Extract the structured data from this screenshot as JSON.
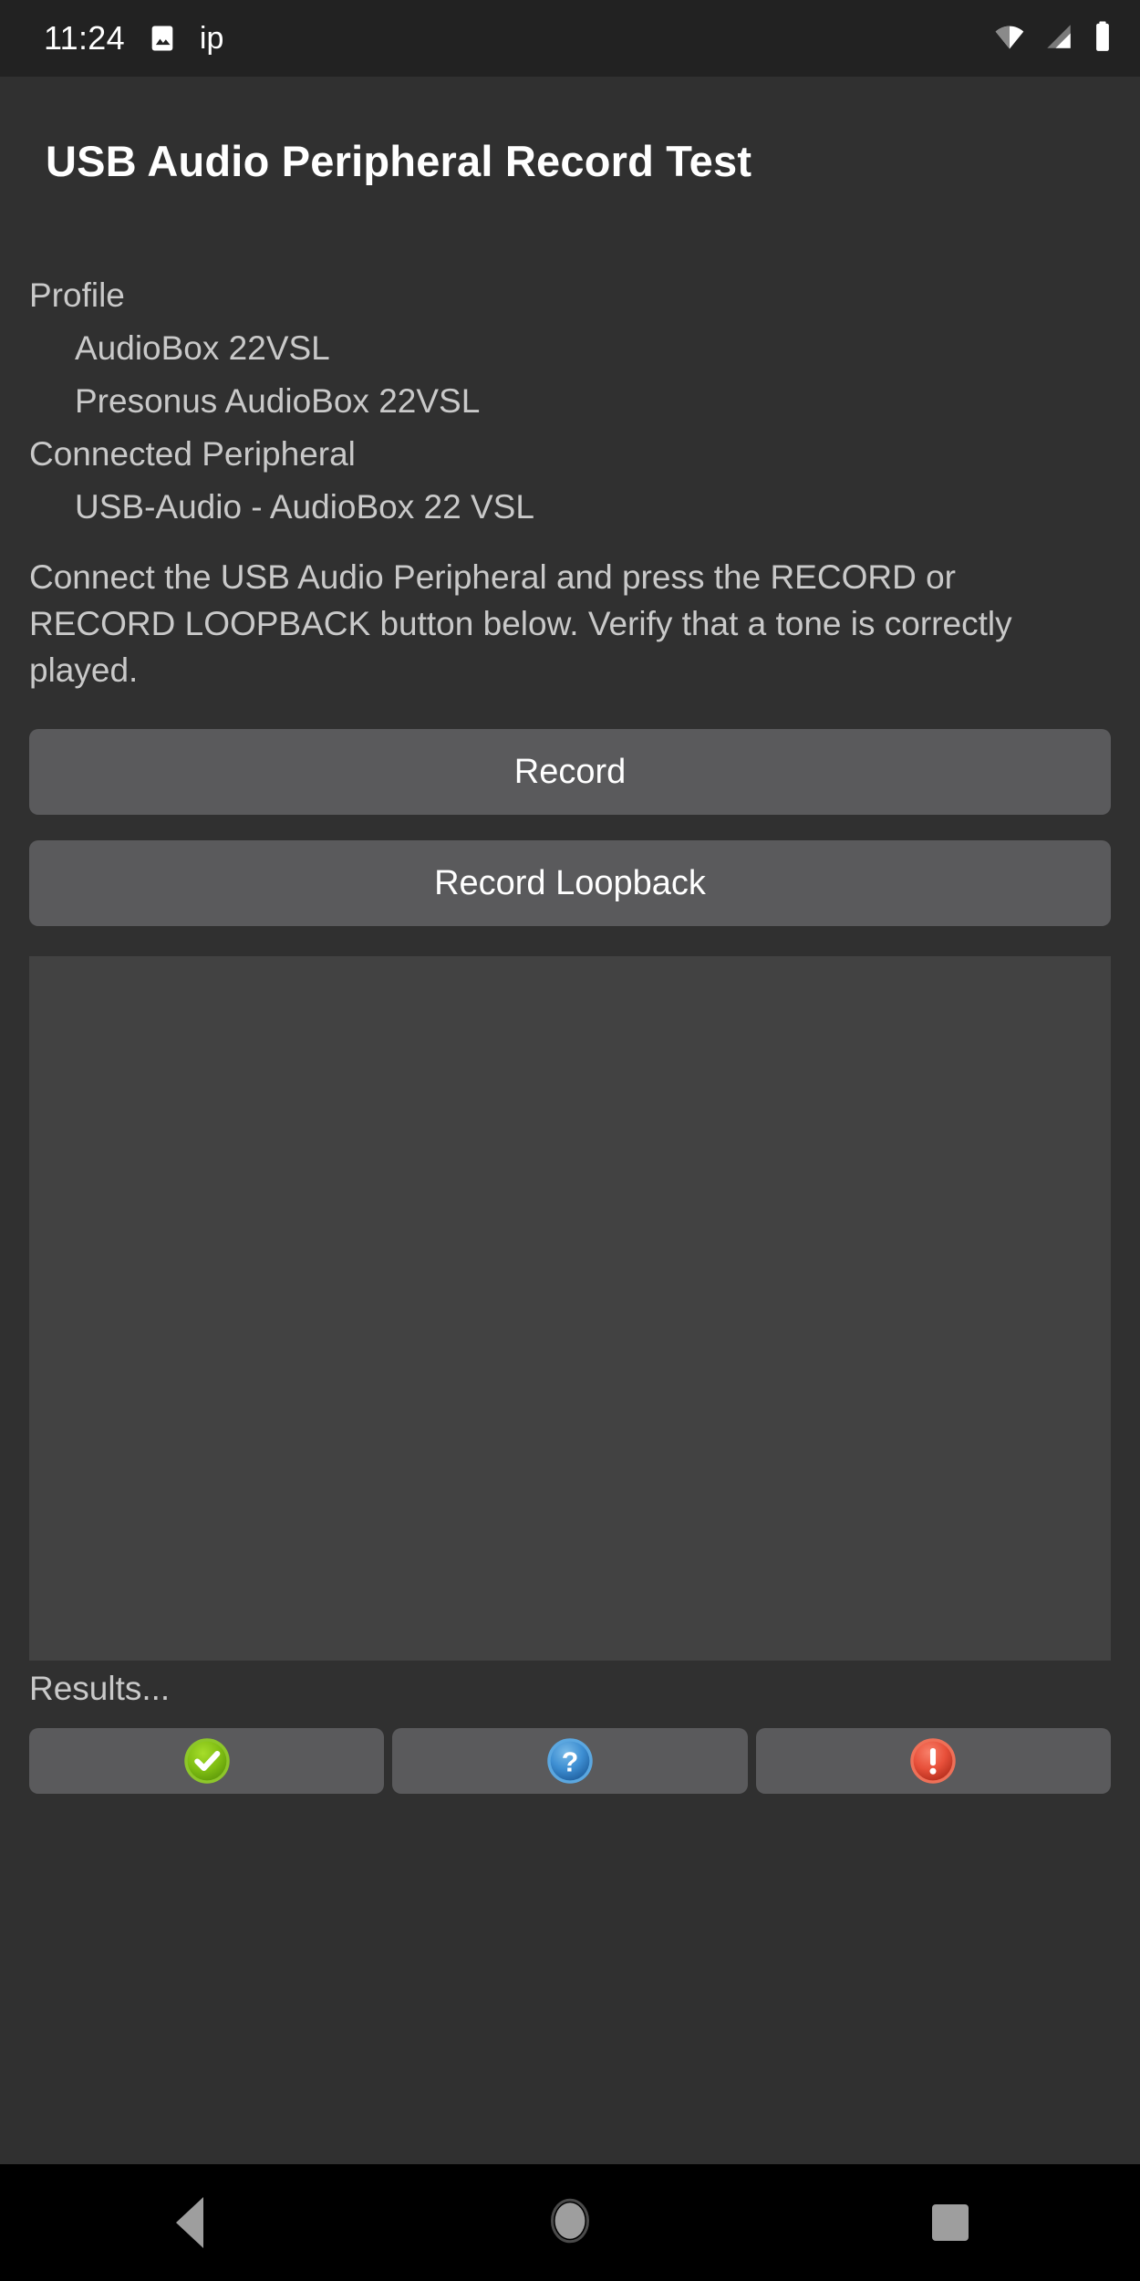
{
  "statusbar": {
    "clock": "11:24",
    "notification_icon": "image-icon",
    "notification_text": "ip",
    "wifi_icon": "wifi-icon",
    "signal_icon": "cellular-signal-icon",
    "battery_icon": "battery-full-icon"
  },
  "appbar": {
    "title": "USB Audio Peripheral Record Test"
  },
  "main": {
    "profile_label": "Profile",
    "profile_name": "AudioBox 22VSL",
    "profile_product": "Presonus AudioBox 22VSL",
    "connected_label": "Connected Peripheral",
    "connected_device": "USB-Audio - AudioBox 22 VSL",
    "instructions": "Connect the USB Audio Peripheral and press the RECORD or RECORD LOOPBACK button below. Verify that a tone is correctly played.",
    "record_button": "Record",
    "record_loopback_button": "Record Loopback",
    "waveform_area": "waveform-canvas",
    "results_label": "Results..."
  },
  "result_buttons": [
    {
      "name": "pass-button",
      "icon": "check-circle-icon",
      "color": "#7cb518"
    },
    {
      "name": "info-button",
      "icon": "question-circle-icon",
      "color": "#3b8ed0"
    },
    {
      "name": "fail-button",
      "icon": "exclamation-circle-icon",
      "color": "#e8503a"
    }
  ],
  "navbar": {
    "back": "back-button",
    "home": "home-button",
    "recents": "recents-button"
  },
  "colors": {
    "background": "#303030",
    "statusbar": "#222222",
    "button": "#5a5a5c",
    "canvas": "#424242",
    "text_primary": "#ffffff",
    "text_secondary": "#c9c9c9",
    "navbar": "#000000"
  }
}
